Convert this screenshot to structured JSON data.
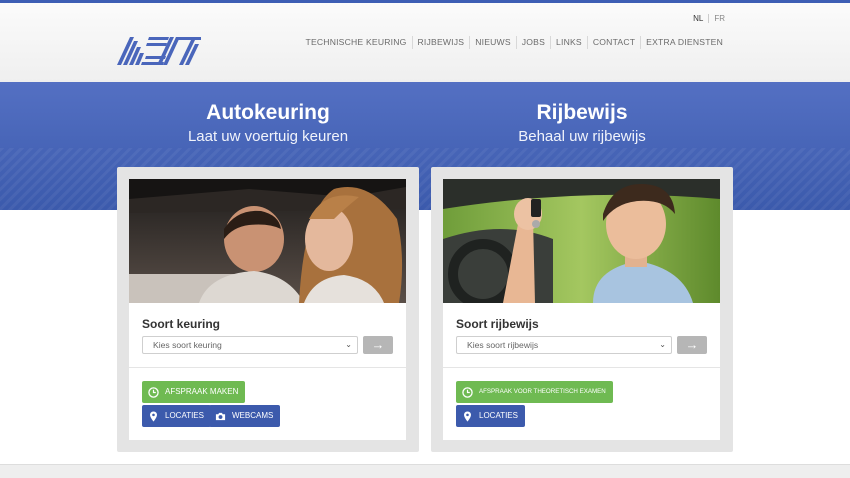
{
  "header": {
    "languages": [
      {
        "code": "NL",
        "active": true
      },
      {
        "code": "FR",
        "active": false
      }
    ],
    "nav": [
      "TECHNISCHE KEURING",
      "RIJBEWIJS",
      "NIEUWS",
      "JOBS",
      "LINKS",
      "CONTACT",
      "EXTRA DIENSTEN"
    ]
  },
  "colors": {
    "brand_blue": "#3c5aac",
    "hero_blue": "#4a66bb",
    "green": "#6fba52",
    "button_grey": "#b6b6b6"
  },
  "sections": [
    {
      "title": "Autokeuring",
      "subtitle": "Laat uw voertuig keuren",
      "photo_subject": "mechanic and woman looking up under car",
      "select_label": "Soort keuring",
      "select_value": "Kies soort keuring",
      "go_icon": "arrow-right-icon",
      "buttons": [
        {
          "label": "AFSPRAAK MAKEN",
          "icon": "clock-icon",
          "color": "green"
        },
        {
          "label": "LOCATIES",
          "icon": "map-pin-icon",
          "color": "blue"
        },
        {
          "label": "WEBCAMS",
          "icon": "camera-icon",
          "color": "blue"
        }
      ]
    },
    {
      "title": "Rijbewijs",
      "subtitle": "Behaal uw rijbewijs",
      "photo_subject": "young man in car holding car keys",
      "select_label": "Soort rijbewijs",
      "select_value": "Kies soort rijbewijs",
      "go_icon": "arrow-right-icon",
      "buttons": [
        {
          "label": "AFSPRAAK VOOR THEORETISCH EXAMEN",
          "icon": "clock-icon",
          "color": "green"
        },
        {
          "label": "LOCATIES",
          "icon": "map-pin-icon",
          "color": "blue"
        }
      ]
    }
  ]
}
